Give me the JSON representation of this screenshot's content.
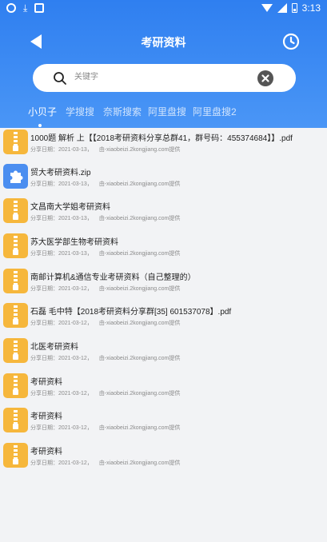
{
  "status_bar": {
    "time": "3:13"
  },
  "header": {
    "title": "考研资料"
  },
  "search": {
    "placeholder": "关键字",
    "value": ""
  },
  "tabs": [
    {
      "label": "小贝子"
    },
    {
      "label": "学搜搜"
    },
    {
      "label": "奈斯搜索"
    },
    {
      "label": "阿里盘搜"
    },
    {
      "label": "阿里盘搜2"
    }
  ],
  "active_tab": "小贝子",
  "items": [
    {
      "title": "1000题 解析 上【【2018考研资料分享总群41，群号码：455374684】】.pdf",
      "date": "分享日期：2021-03-13，",
      "by": "由-xiaobeizi.2kongjiang.com提供",
      "icon": "zip-icon"
    },
    {
      "title": "贸大考研资料.zip",
      "date": "分享日期：2021-03-13，",
      "by": "由-xiaobeizi.2kongjiang.com提供",
      "icon": "plugin-icon"
    },
    {
      "title": "文昌南大学姐考研资料",
      "date": "分享日期：2021-03-13，",
      "by": "由-xiaobeizi.2kongjiang.com提供",
      "icon": "zip-icon"
    },
    {
      "title": "苏大医学部生物考研资料",
      "date": "分享日期：2021-03-13，",
      "by": "由-xiaobeizi.2kongjiang.com提供",
      "icon": "zip-icon"
    },
    {
      "title": "南邮计算机&通信专业考研资料（自己整理的）",
      "date": "分享日期：2021-03-12，",
      "by": "由-xiaobeizi.2kongjiang.com提供",
      "icon": "zip-icon"
    },
    {
      "title": "石磊 毛中特【2018考研资料分享群[35] 601537078】.pdf",
      "date": "分享日期：2021-03-12，",
      "by": "由-xiaobeizi.2kongjiang.com提供",
      "icon": "zip-icon"
    },
    {
      "title": "北医考研资料",
      "date": "分享日期：2021-03-12，",
      "by": "由-xiaobeizi.2kongjiang.com提供",
      "icon": "zip-icon"
    },
    {
      "title": "考研资料",
      "date": "分享日期：2021-03-12，",
      "by": "由-xiaobeizi.2kongjiang.com提供",
      "icon": "zip-icon"
    },
    {
      "title": "考研资料",
      "date": "分享日期：2021-03-12，",
      "by": "由-xiaobeizi.2kongjiang.com提供",
      "icon": "zip-icon"
    },
    {
      "title": "考研资料",
      "date": "分享日期：2021-03-12，",
      "by": "由-xiaobeizi.2kongjiang.com提供",
      "icon": "zip-icon"
    }
  ],
  "colors": {
    "header_top": "#2f7ff0",
    "header_bottom": "#4a96f6",
    "zip_icon": "#f6b73c",
    "plugin_icon": "#4b8ef0",
    "background": "#f2f3f5"
  }
}
